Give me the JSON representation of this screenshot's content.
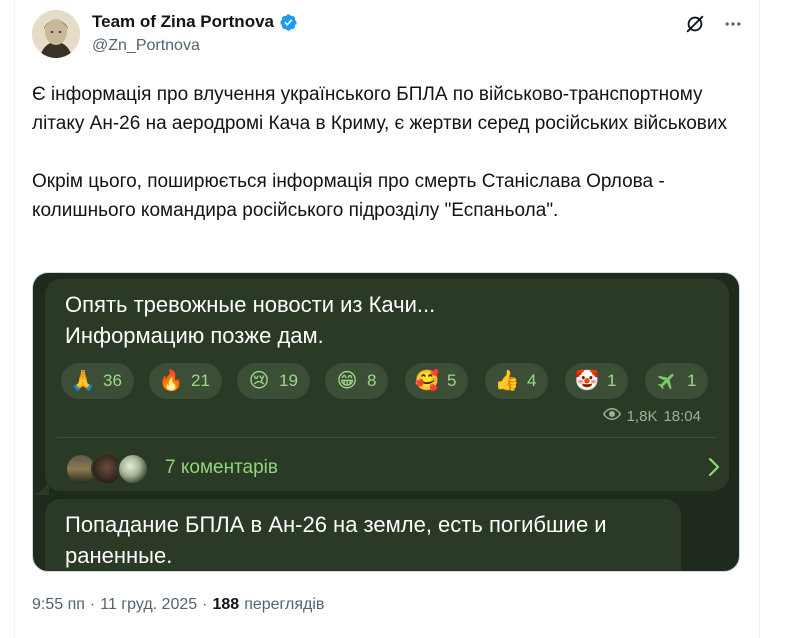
{
  "author": {
    "display_name": "Team of Zina Portnova",
    "handle": "@Zn_Portnova",
    "verified_color": "#1d9bf0"
  },
  "tweet": {
    "paragraphs": [
      "Є інформація про влучення українського БПЛА по військово-транспортному літаку Ан-26 на аеродромі Кача в Криму, є жертви серед російських військових",
      "Окрім цього, поширюється інформація про смерть Станіслава Орлова - колишнього командира російського підрозділу \"Еспаньола\"."
    ]
  },
  "media": {
    "message1": {
      "lines": [
        "Опять тревожные новости из Качи...",
        "Информацию позже дам."
      ],
      "reactions": [
        {
          "emoji": "🙏",
          "icon": "folded-hands-icon",
          "count": "36"
        },
        {
          "emoji": "🔥",
          "icon": "fire-icon",
          "count": "21"
        },
        {
          "emoji": "😢",
          "icon": "crying-face-icon",
          "count": "19"
        },
        {
          "emoji": "😁",
          "icon": "grinning-face-icon",
          "count": "8"
        },
        {
          "emoji": "🥰",
          "icon": "smiling-hearts-icon",
          "count": "5"
        },
        {
          "emoji": "👍",
          "icon": "thumbs-up-icon",
          "count": "4"
        },
        {
          "emoji": "🤡",
          "icon": "clown-face-icon",
          "count": "1"
        },
        {
          "emoji": "✈",
          "icon": "airplane-icon",
          "count": "1"
        }
      ],
      "views": "1,8K",
      "time": "18:04",
      "comments_label": "7 коментарів"
    },
    "message2": {
      "lines": [
        "Попадание БПЛА в Ан-26 на земле, есть погибшие и",
        "раненные."
      ]
    }
  },
  "footer": {
    "time": "9:55 пп",
    "separator": "·",
    "date": "11 груд. 2025",
    "views_count": "188",
    "views_label": "переглядів"
  },
  "colors": {
    "chat_bg": "#1e2a1b",
    "bubble": "#2b3a26",
    "reaction_bg": "#3c4e35",
    "accent_green": "#8fd57c",
    "muted": "#536471"
  }
}
